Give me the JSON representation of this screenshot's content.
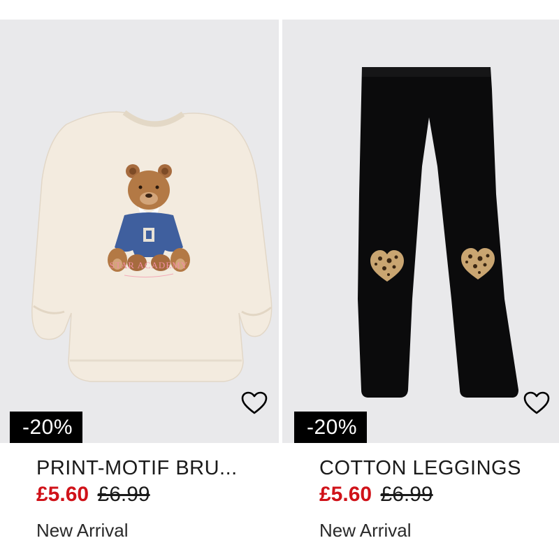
{
  "products": [
    {
      "name": "PRINT-MOTIF BRU...",
      "price_now": "£5.60",
      "price_was": "£6.99",
      "discount": "-20%",
      "tag": "New Arrival",
      "sweatshirt_print": "STAR ACADEMY",
      "favorite_icon": "heart-outline",
      "image_background": "#e9e9eb",
      "garment_color": "#f3ebdf"
    },
    {
      "name": "COTTON LEGGINGS",
      "price_now": "£5.60",
      "price_was": "£6.99",
      "discount": "-20%",
      "tag": "New Arrival",
      "favorite_icon": "heart-outline",
      "image_background": "#e9e9eb",
      "garment_color": "#0b0b0c"
    }
  ],
  "colors": {
    "sale_price": "#d01219",
    "badge_bg": "#000000",
    "badge_text": "#ffffff"
  }
}
